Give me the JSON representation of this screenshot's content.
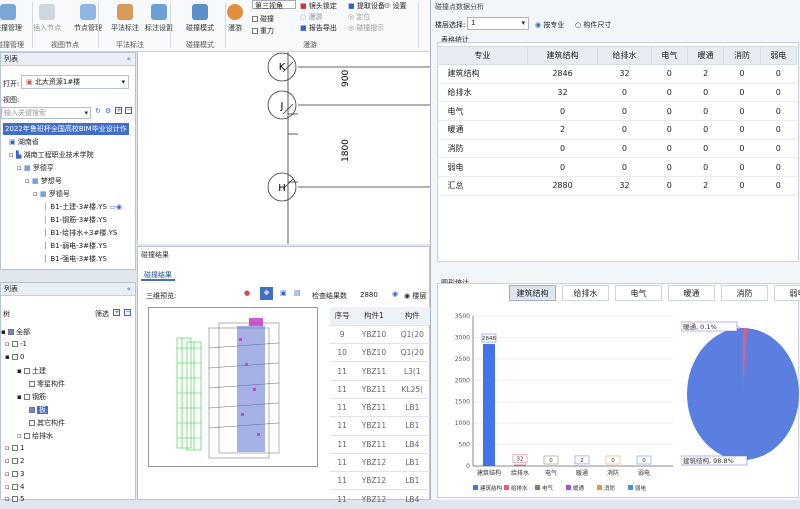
{
  "ribbon": {
    "buttons": [
      "碰撞管理",
      "插入节点",
      "节点管理",
      "平法标注",
      "标注设置",
      "碰撞模式",
      "漫游"
    ],
    "groups": [
      "碰撞管理",
      "视图节点",
      "平法标注",
      "碰撞模式",
      "漫游"
    ],
    "view_select": "第三视角",
    "checks": [
      "碰撞",
      "重力"
    ],
    "opts": [
      "镜头锁定",
      "提取设备",
      "设置",
      "漫游",
      "定位",
      "碰撞提示",
      "报告导出"
    ]
  },
  "left_top": {
    "title": "列表",
    "open_label": "打开:",
    "open_value": "北大资源1#楼",
    "view_label": "视图:",
    "search_placeholder": "输入关键搜索",
    "tree": [
      "2022年鲁班杯全国高校BIM毕业设计作",
      "湖南省",
      "湖南工程职业技术学院",
      "罗德亨",
      "梦想号",
      "罗德号",
      "B1-土建-3#楼.YS",
      "B1-钢筋-3#楼.YS",
      "B1-给排水+3#楼.YS",
      "B1-弱电-3#楼.YS",
      "B1-强电-3#楼.YS"
    ]
  },
  "left_bottom": {
    "title": "列表",
    "sub": "树",
    "filter": "筛选",
    "tree": [
      "全部",
      "-1",
      "0",
      "土建",
      "零星构件",
      "钢筋",
      "板",
      "其它构件",
      "给排水",
      "1",
      "2",
      "3",
      "4",
      "5"
    ]
  },
  "drawing": {
    "axes": [
      "K",
      "J",
      "H"
    ],
    "dims": [
      "900",
      "1800"
    ]
  },
  "results": {
    "panel_title": "碰撞结果",
    "tab": "碰撞结果",
    "preview": "三维预览:",
    "count_label": "检查结果数",
    "count": "2880",
    "floor_label": "楼层",
    "headers": [
      "序号",
      "构件1",
      "构件"
    ],
    "rows": [
      [
        "9",
        "YBZ10",
        "Q1(20"
      ],
      [
        "10",
        "YBZ10",
        "Q1(20"
      ],
      [
        "11",
        "YBZ11",
        "L3(1"
      ],
      [
        "11",
        "YBZ11",
        "KL25("
      ],
      [
        "11",
        "YBZ11",
        "LB1"
      ],
      [
        "11",
        "YBZ11",
        "LB1"
      ],
      [
        "11",
        "YBZ11",
        "LB4"
      ],
      [
        "11",
        "YBZ12",
        "LB1"
      ],
      [
        "11",
        "YBZ12",
        "LB1"
      ],
      [
        "11",
        "YBZ12",
        "LB4"
      ]
    ]
  },
  "right": {
    "title": "碰撞点数据分析",
    "floor_label": "楼层选择:",
    "floor_value": "1",
    "radio1": "按专业",
    "radio2": "构件尺寸",
    "table_title": "表格统计",
    "headers": [
      "专业",
      "建筑结构",
      "给排水",
      "电气",
      "暖通",
      "消防",
      "弱电"
    ],
    "rows": [
      [
        "建筑结构",
        "2846",
        "32",
        "0",
        "2",
        "0",
        "0"
      ],
      [
        "给排水",
        "32",
        "0",
        "0",
        "0",
        "0",
        "0"
      ],
      [
        "电气",
        "0",
        "0",
        "0",
        "0",
        "0",
        "0"
      ],
      [
        "暖通",
        "2",
        "0",
        "0",
        "0",
        "0",
        "0"
      ],
      [
        "消防",
        "0",
        "0",
        "0",
        "0",
        "0",
        "0"
      ],
      [
        "弱电",
        "0",
        "0",
        "0",
        "0",
        "0",
        "0"
      ],
      [
        "汇总",
        "2880",
        "32",
        "0",
        "2",
        "0",
        "0"
      ]
    ],
    "chart_title": "图形统计",
    "tabs": [
      "建筑结构",
      "给排水",
      "电气",
      "暖通",
      "消防",
      "弱电"
    ],
    "pie_labels": [
      "暖通, 0.1%",
      "建筑结构, 98.8%"
    ]
  },
  "chart_data": {
    "type": "bar",
    "categories": [
      "建筑结构",
      "给排水",
      "电气",
      "暖通",
      "消防",
      "弱电"
    ],
    "values": [
      2846,
      32,
      0,
      2,
      0,
      0
    ],
    "ylim": [
      0,
      3500
    ],
    "yticks": [
      0,
      500,
      1000,
      1500,
      2000,
      2500,
      3000,
      3500
    ],
    "colors": [
      "#4472e8",
      "#e65c7a",
      "#6f8a5a",
      "#9b59d0",
      "#e69a35",
      "#4a8fd8"
    ],
    "legend": [
      "建筑结构",
      "给排水",
      "电气",
      "暖通",
      "消防",
      "弱电"
    ]
  }
}
